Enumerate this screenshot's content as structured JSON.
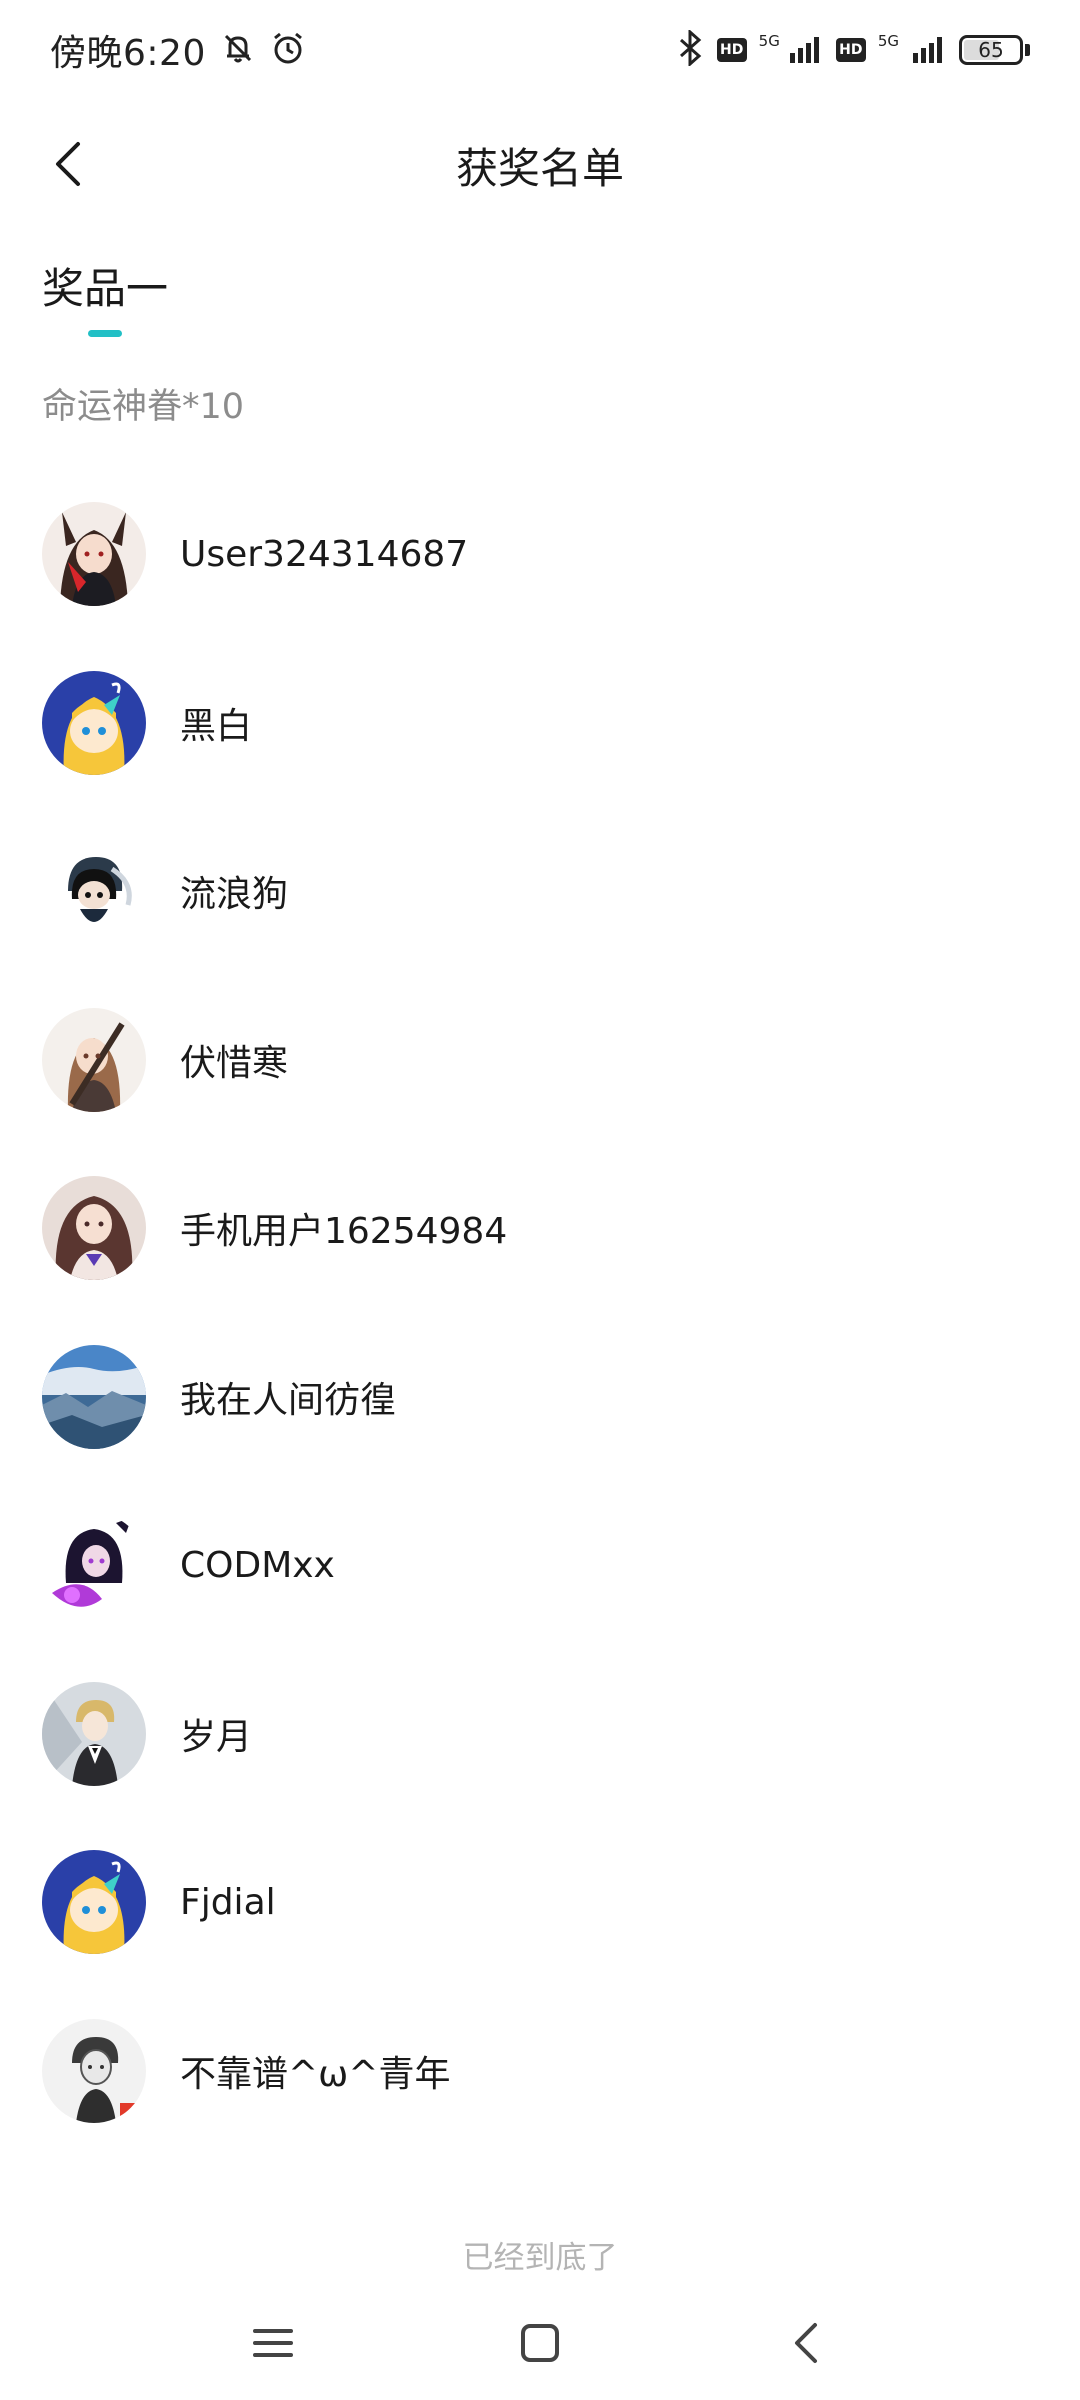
{
  "status_bar": {
    "time": "傍晚6:20",
    "network_1": "5G",
    "network_2": "5G",
    "hd_label": "HD",
    "battery": "65",
    "battery_level": 0.65
  },
  "header": {
    "title": "获奖名单"
  },
  "prize": {
    "tab_label": "奖品一",
    "subtitle": "命运神眷*10",
    "accent_color": "#22c0c6"
  },
  "winners": [
    {
      "name": "User324314687",
      "avatar": "anime-girl-red-avatar"
    },
    {
      "name": "黑白",
      "avatar": "blue-mascot-avatar"
    },
    {
      "name": "流浪狗",
      "avatar": "chibi-dark-hair-avatar"
    },
    {
      "name": "伏惜寒",
      "avatar": "anime-girl-rifle-avatar"
    },
    {
      "name": "手机用户16254984",
      "avatar": "anime-girl-brown-avatar"
    },
    {
      "name": "我在人间彷徨",
      "avatar": "landscape-avatar"
    },
    {
      "name": "CODMxx",
      "avatar": "purple-character-avatar"
    },
    {
      "name": "岁月",
      "avatar": "anime-boy-suit-avatar"
    },
    {
      "name": "Fjdial",
      "avatar": "blue-mascot-avatar"
    },
    {
      "name": "不靠谱^ω^青年",
      "avatar": "sketch-portrait-avatar"
    }
  ],
  "footer": {
    "end_text": "已经到底了"
  }
}
